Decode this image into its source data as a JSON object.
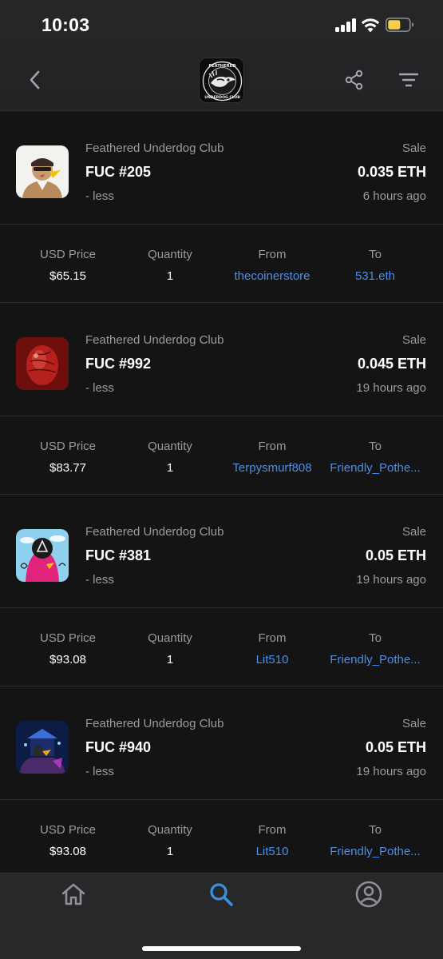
{
  "status_bar": {
    "time": "10:03"
  },
  "nav": {
    "back_icon": "chevron-left-icon",
    "logo_text_top": "FEATHERED",
    "logo_text_bottom": "UNDERDOG CLUB",
    "share_icon": "share-icon",
    "filter_icon": "filter-icon"
  },
  "detail_labels": {
    "usd_price": "USD Price",
    "quantity": "Quantity",
    "from": "From",
    "to": "To"
  },
  "sales": [
    {
      "collection": "Feathered Underdog Club",
      "token": "FUC #205",
      "note": "- less",
      "event": "Sale",
      "price": "0.035 ETH",
      "time_ago": "6 hours ago",
      "usd_price": "$65.15",
      "quantity": "1",
      "from": "thecoinerstore",
      "to": "531.eth"
    },
    {
      "collection": "Feathered Underdog Club",
      "token": "FUC #992",
      "note": "- less",
      "event": "Sale",
      "price": "0.045 ETH",
      "time_ago": "19 hours ago",
      "usd_price": "$83.77",
      "quantity": "1",
      "from": "Terpysmurf808",
      "to": "Friendly_Pothe..."
    },
    {
      "collection": "Feathered Underdog Club",
      "token": "FUC #381",
      "note": "- less",
      "event": "Sale",
      "price": "0.05 ETH",
      "time_ago": "19 hours ago",
      "usd_price": "$93.08",
      "quantity": "1",
      "from": "Lit510",
      "to": "Friendly_Pothe..."
    },
    {
      "collection": "Feathered Underdog Club",
      "token": "FUC #940",
      "note": "- less",
      "event": "Sale",
      "price": "0.05 ETH",
      "time_ago": "19 hours ago",
      "usd_price": "$93.08",
      "quantity": "1",
      "from": "Lit510",
      "to": "Friendly_Pothe..."
    }
  ],
  "tabbar": {
    "home_icon": "home-icon",
    "search_icon": "search-icon",
    "account_icon": "account-icon",
    "active_tab": "search"
  },
  "colors": {
    "background": "#141414",
    "header": "#262728",
    "link": "#4a8fe8",
    "muted_text": "#9a9ba0",
    "active_tab": "#3d8fe0",
    "inactive_tab": "#8e8f93",
    "battery": "#f5d04c"
  }
}
